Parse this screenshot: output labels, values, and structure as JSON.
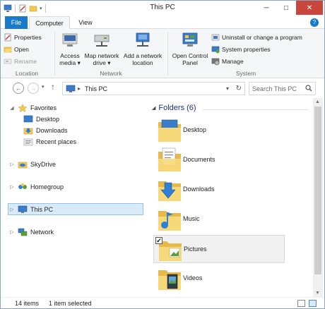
{
  "window": {
    "title": "This PC"
  },
  "window_controls": {
    "minimize": "─",
    "maximize": "□",
    "close": "✕"
  },
  "tabs": {
    "file": "File",
    "computer": "Computer",
    "view": "View",
    "help": "?"
  },
  "ribbon": {
    "location": {
      "label": "Location",
      "properties": "Properties",
      "open": "Open",
      "rename": "Rename"
    },
    "network": {
      "label": "Network",
      "access_media": [
        "Access",
        "media ▾"
      ],
      "map_drive": [
        "Map network",
        "drive ▾"
      ],
      "add_location": [
        "Add a network",
        "location"
      ]
    },
    "system": {
      "label": "System",
      "control_panel": [
        "Open Control",
        "Panel"
      ],
      "uninstall": "Uninstall or change a program",
      "system_properties": "System properties",
      "manage": "Manage"
    }
  },
  "address": {
    "path": "This PC",
    "search_placeholder": "Search This PC",
    "back": "←",
    "forward": "→",
    "up": "↑",
    "recent": "▾",
    "separator": "▸",
    "dropdown": "▾",
    "refresh": "↻"
  },
  "navpane": {
    "expand": "▷",
    "collapse": "◢",
    "favorites": "Favorites",
    "favorites_items": [
      "Desktop",
      "Downloads",
      "Recent places"
    ],
    "skydrive": "SkyDrive",
    "homegroup": "Homegroup",
    "this_pc": "This PC",
    "network": "Network"
  },
  "content": {
    "group_header": "Folders (6)",
    "caret": "◢",
    "folders": [
      {
        "name": "Desktop"
      },
      {
        "name": "Documents"
      },
      {
        "name": "Downloads"
      },
      {
        "name": "Music"
      },
      {
        "name": "Pictures",
        "selected": true,
        "check": "✔"
      },
      {
        "name": "Videos"
      }
    ]
  },
  "scroll": {
    "up": "▲",
    "down": "▼"
  },
  "statusbar": {
    "items": "14 items",
    "selected": "1 item selected"
  },
  "colors": {
    "accent": "#1979ca",
    "close": "#c9463d",
    "folder": "#f2c94c",
    "selection": "#d9ebf9"
  }
}
